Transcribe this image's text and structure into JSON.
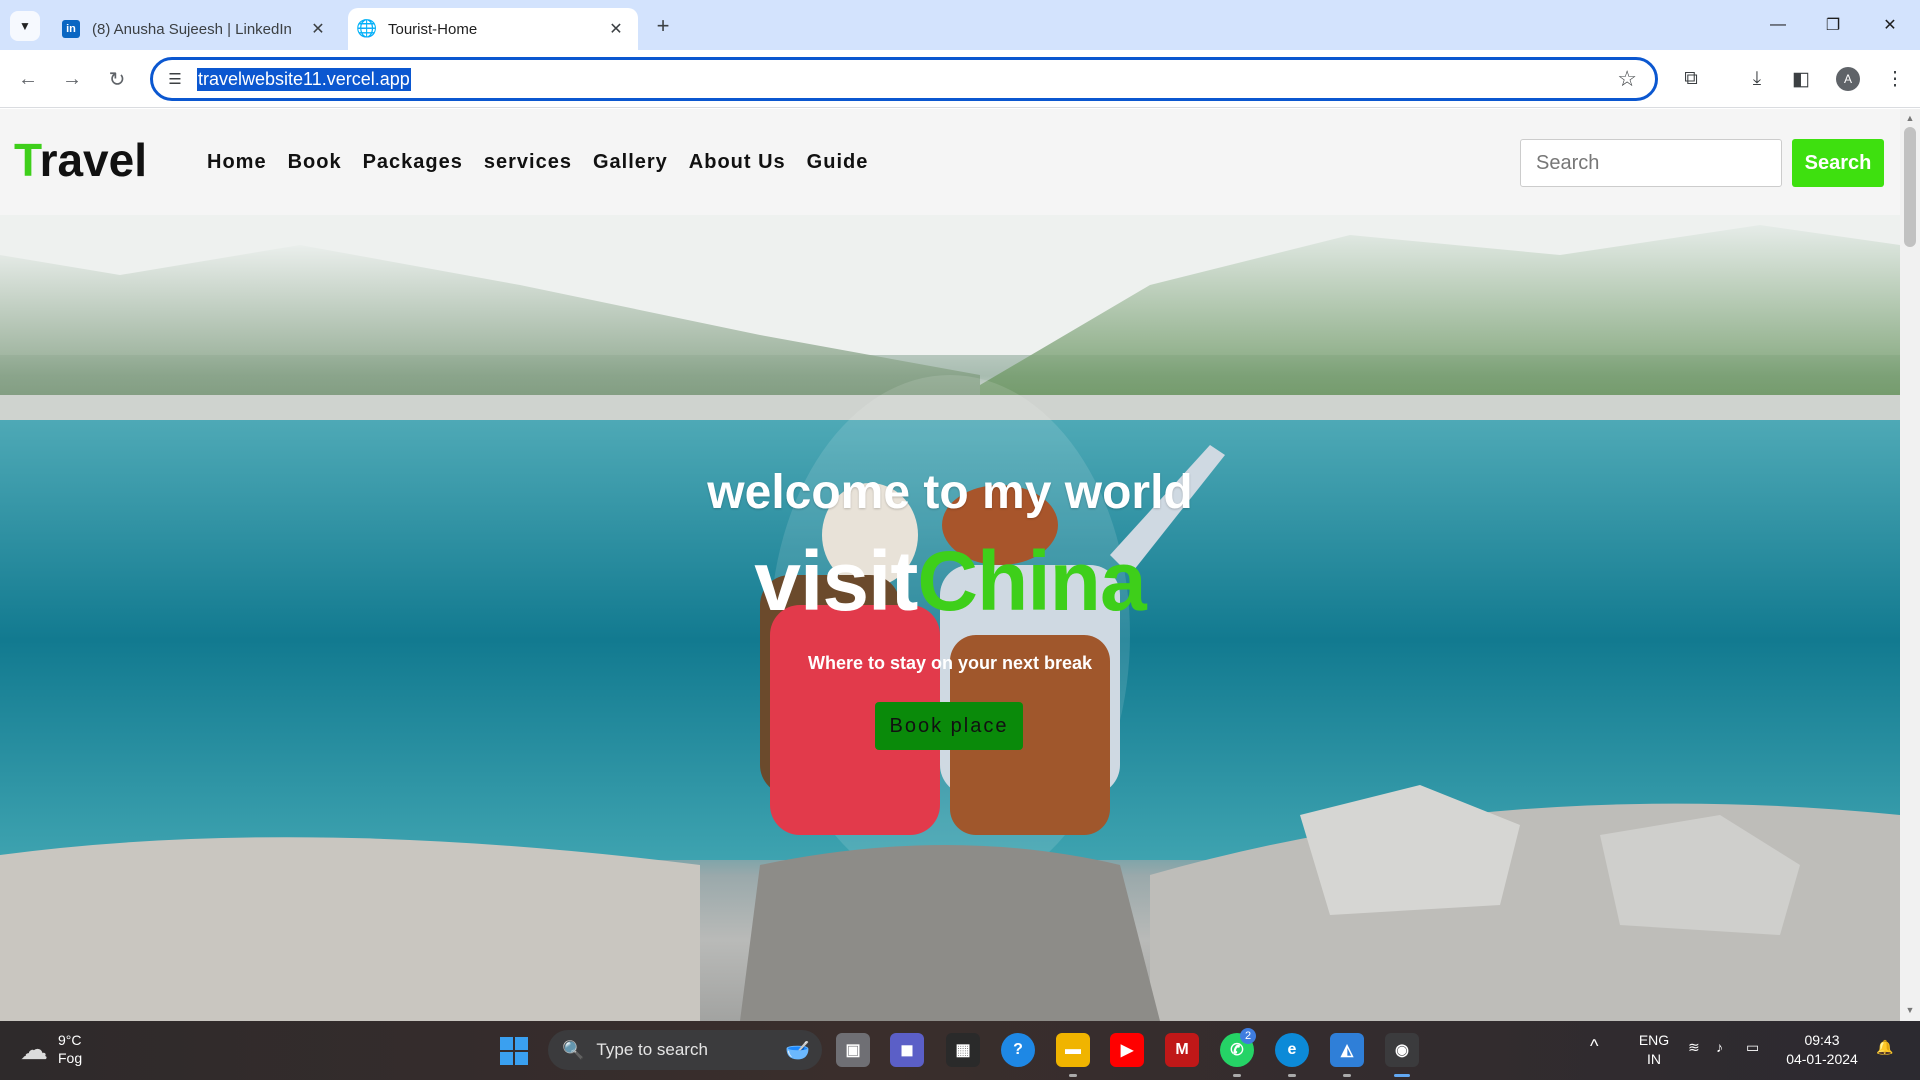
{
  "browser": {
    "tabs": [
      {
        "title": "(8) Anusha Sujeesh | LinkedIn",
        "icon": "linkedin-icon",
        "active": false
      },
      {
        "title": "Tourist-Home",
        "icon": "globe-icon",
        "active": true
      }
    ],
    "url": "travelwebsite11.vercel.app",
    "profile_initial": "A"
  },
  "site": {
    "logo_first": "T",
    "logo_rest": "ravel",
    "nav": [
      "Home",
      "Book",
      "Packages",
      "services",
      "Gallery",
      "About Us",
      "Guide"
    ],
    "search_placeholder": "Search",
    "search_button": "Search",
    "accent_color": "#3ecf1a"
  },
  "hero": {
    "welcome": "welcome to my world",
    "visit_prefix": "visit",
    "visit_place": "China",
    "subline": "Where to stay on your next break",
    "book_button": "Book place"
  },
  "taskbar": {
    "weather_temp": "9°C",
    "weather_desc": "Fog",
    "search_placeholder": "Type to search",
    "lang_top": "ENG",
    "lang_bottom": "IN",
    "time": "09:43",
    "date": "04-01-2024",
    "whatsapp_badge": "2"
  }
}
